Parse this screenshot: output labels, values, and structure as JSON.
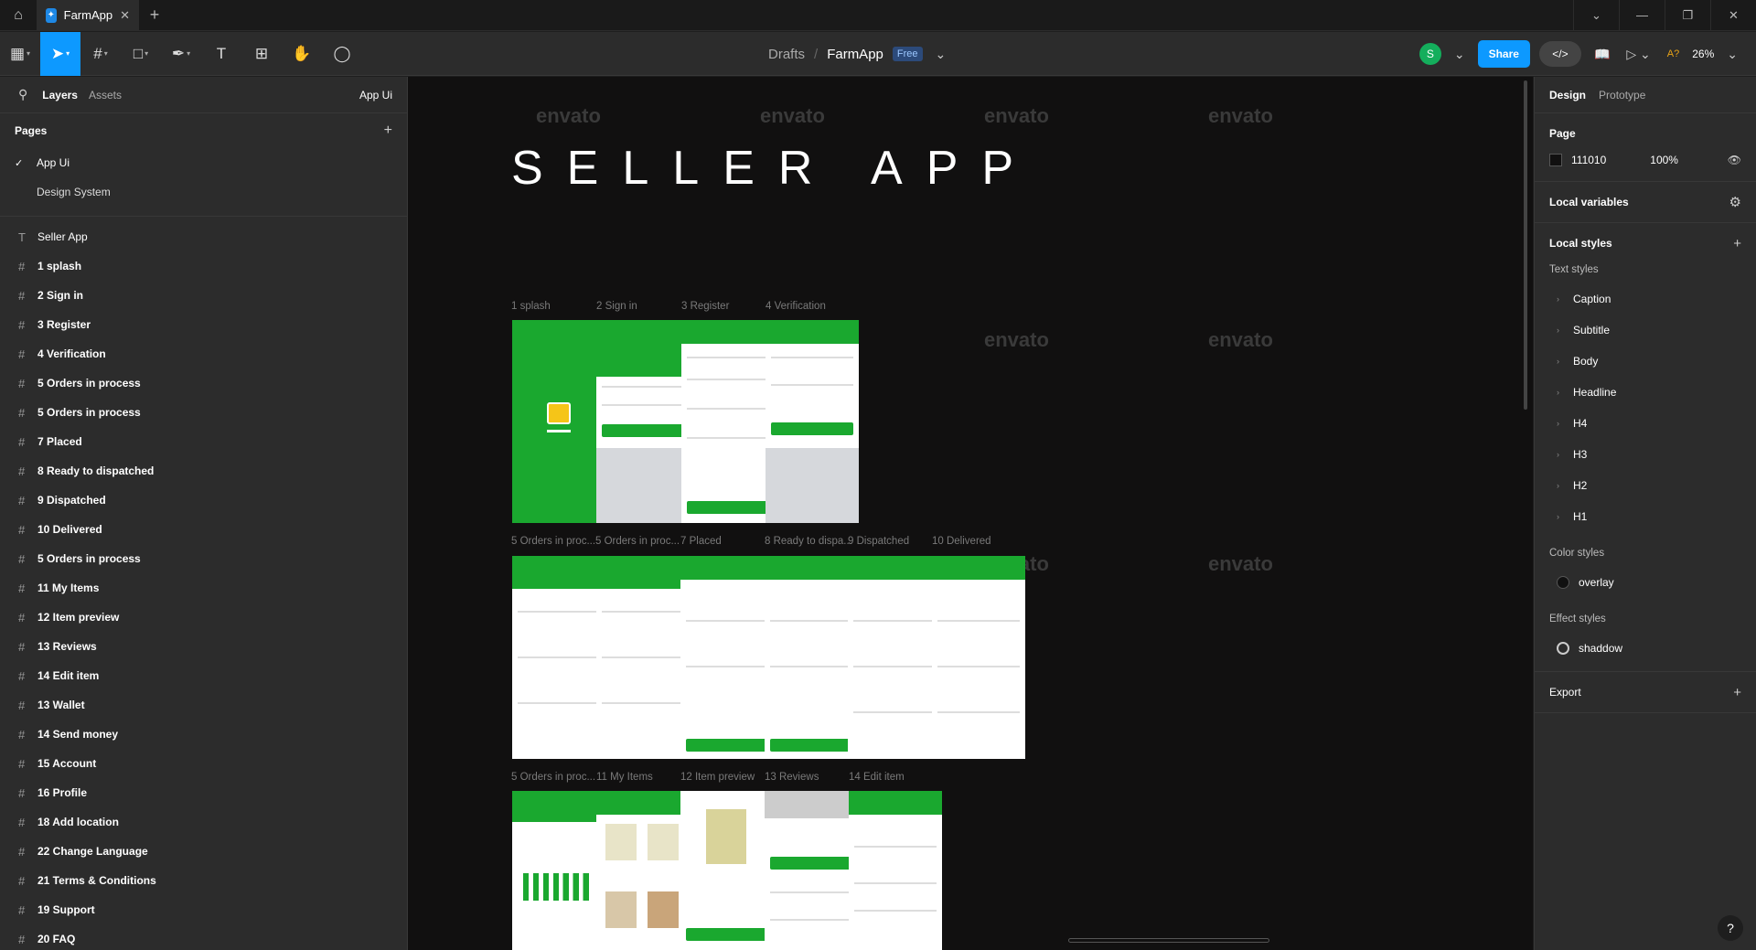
{
  "tabbar": {
    "tab_title": "FarmApp",
    "close": "✕",
    "new": "+"
  },
  "toolbar": {
    "breadcrumb": "Drafts",
    "file": "FarmApp",
    "plan": "Free",
    "share": "Share",
    "zoom": "26%",
    "avatar": "S",
    "accessibility": "A?"
  },
  "left": {
    "tabs": [
      "Layers",
      "Assets"
    ],
    "page_selector": "App Ui",
    "pages_header": "Pages",
    "pages": [
      "App Ui",
      "Design System"
    ],
    "layers": [
      "Seller App",
      "1 splash",
      "2 Sign in",
      "3 Register",
      "4 Verification",
      "5 Orders in process",
      "5 Orders in process",
      "7 Placed",
      "8 Ready to dispatched",
      "9 Dispatched",
      "10 Delivered",
      "5 Orders in process",
      "11 My Items",
      "12 Item preview",
      "13 Reviews",
      "14 Edit item",
      "13 Wallet",
      "14 Send money",
      "15 Account",
      "16 Profile",
      "18 Add location",
      "22 Change Language",
      "21 Terms & Conditions",
      "19 Support",
      "20 FAQ"
    ]
  },
  "canvas": {
    "title": "SELLER APP",
    "watermark": "envato",
    "row1": [
      "1 splash",
      "2 Sign in",
      "3 Register",
      "4 Verification"
    ],
    "row2": [
      "5 Orders in proc...",
      "5 Orders in proc...",
      "7 Placed",
      "8 Ready to dispa...",
      "9 Dispatched",
      "10 Delivered"
    ],
    "row3": [
      "5 Orders in proc...",
      "11 My Items",
      "12 Item preview",
      "13 Reviews",
      "14 Edit item"
    ]
  },
  "right": {
    "tabs": [
      "Design",
      "Prototype"
    ],
    "page_label": "Page",
    "page_color": "111010",
    "page_opacity": "100%",
    "local_variables": "Local variables",
    "local_styles": "Local styles",
    "text_styles_label": "Text styles",
    "text_styles": [
      "Caption",
      "Subtitle",
      "Body",
      "Headline",
      "H4",
      "H3",
      "H2",
      "H1"
    ],
    "color_styles_label": "Color styles",
    "color_style": "overlay",
    "effect_styles_label": "Effect styles",
    "effect_style": "shaddow",
    "export": "Export",
    "help": "?"
  }
}
